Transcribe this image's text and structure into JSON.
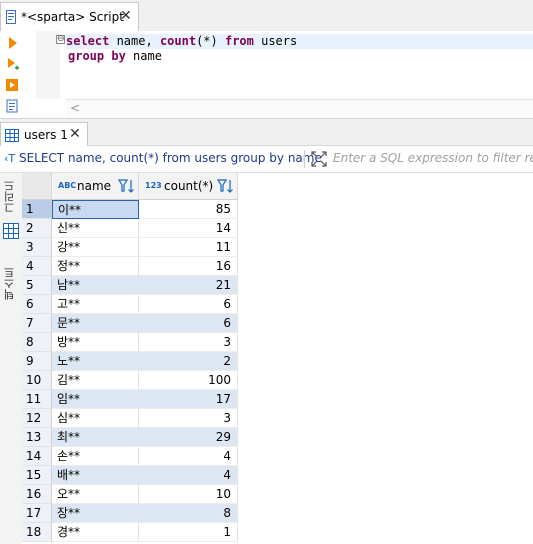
{
  "editor_tab": {
    "title": "*<sparta> Script",
    "close": "✕"
  },
  "editor": {
    "line1": {
      "kw1": "select",
      "t1": " name, ",
      "kw2": "count",
      "t2": "(*) ",
      "kw3": "from",
      "t3": " users"
    },
    "line2": {
      "kw1": "group",
      "t1": " ",
      "kw2": "by",
      "t2": " name"
    },
    "fold": "⊖",
    "scroll_left": "<"
  },
  "results_tab": {
    "title": "users 1",
    "close": "✕"
  },
  "filter": {
    "query_icon": "‹T",
    "query": "SELECT name, count(*) from users group by name",
    "placeholder": "Enter a SQL expression to filter results (use Ctrl+Space)"
  },
  "side_tabs": {
    "grid": "그리드",
    "text": "텍스트"
  },
  "columns": {
    "name": {
      "type": "ABC",
      "label": "name"
    },
    "count": {
      "type": "123",
      "label": "count(*)"
    }
  },
  "rows": [
    {
      "n": "1",
      "name": "이**",
      "count": "85"
    },
    {
      "n": "2",
      "name": "신**",
      "count": "14"
    },
    {
      "n": "3",
      "name": "강**",
      "count": "11"
    },
    {
      "n": "4",
      "name": "정**",
      "count": "16"
    },
    {
      "n": "5",
      "name": "남**",
      "count": "21"
    },
    {
      "n": "6",
      "name": "고**",
      "count": "6"
    },
    {
      "n": "7",
      "name": "문**",
      "count": "6"
    },
    {
      "n": "8",
      "name": "방**",
      "count": "3"
    },
    {
      "n": "9",
      "name": "노**",
      "count": "2"
    },
    {
      "n": "10",
      "name": "김**",
      "count": "100"
    },
    {
      "n": "11",
      "name": "임**",
      "count": "17"
    },
    {
      "n": "12",
      "name": "심**",
      "count": "3"
    },
    {
      "n": "13",
      "name": "최**",
      "count": "29"
    },
    {
      "n": "14",
      "name": "손**",
      "count": "4"
    },
    {
      "n": "15",
      "name": "배**",
      "count": "4"
    },
    {
      "n": "16",
      "name": "오**",
      "count": "10"
    },
    {
      "n": "17",
      "name": "장**",
      "count": "8"
    },
    {
      "n": "18",
      "name": "경**",
      "count": "1"
    }
  ],
  "colors": {
    "keyword": "#7f0055",
    "accent": "#1565c0",
    "alt_row": "#dde7f3"
  }
}
